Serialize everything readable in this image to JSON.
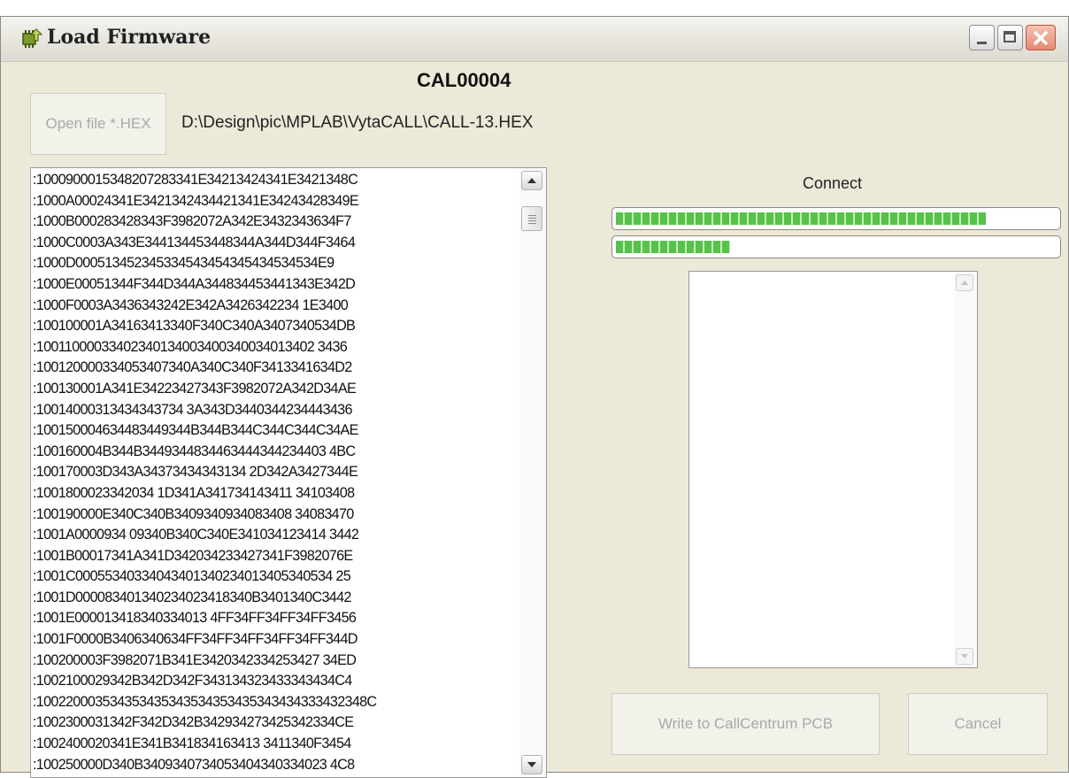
{
  "window": {
    "title": "Load Firmware",
    "minimize_icon": "minimize-icon",
    "maximize_icon": "maximize-icon",
    "close_icon": "close-icon"
  },
  "header": {
    "open_button_label": "Open file *.HEX",
    "device_id": "CAL00004",
    "file_path": "D:\\Design\\pic\\MPLAB\\VytaCALL\\CALL-13.HEX"
  },
  "hex_lines": [
    ":1000900015348207283341E34213424341E3421348C",
    ":1000A00024341E3421342434421341E34243428349E",
    ":1000B000283428343F3982072A342E3432343634F7",
    ":1000C0003A343E344134453448344A344D344F3464",
    ":1000D000513452345334543454345434534534E9",
    ":1000E00051344F344D344A344834453441343E342D",
    ":1000F0003A3436343242E342A3426342234 1E3400",
    ":100100001A34163413340F340C340A3407340534DB",
    ":10011000033402340134003400340034013402 3436",
    ":100120000334053407340A340C340F3413341634D2",
    ":100130001A341E34223427343F3982072A342D34AE",
    ":10014000313434343734 3A343D3440344234443436",
    ":100150004634483449344B344B344C344C344C34AE",
    ":100160004B344B3449344834463444344234403 4BC",
    ":100170003D343A34373434343134 2D342A3427344E",
    ":1001800023342034 1D341A341734143411 34103408",
    ":100190000E340C340B3409340934083408 34083470",
    ":1001A0000934 09340B340C340E341034123414 3442",
    ":1001B00017341A341D342034233427341F3982076E",
    ":1001C00055340334043401340234013405340534 25",
    ":1001D000083401340234023418340B3401340C3442",
    ":1001E000013418340334013 4FF34FF34FF34FF3456",
    ":1001F0000B3406340634FF34FF34FF34FF34FF344D",
    ":100200003F3982071B341E3420342334253427 34ED",
    ":1002100029342B342D342F343134323433343434C4",
    ":100220003534353435343534353435343434333432348C",
    ":1002300031342F342D342B342934273425342334CE",
    ":1002400020341E341B341834163413 3411340F3454",
    ":100250000D340B3409340734053404340334023 4C8"
  ],
  "connect": {
    "label": "Connect",
    "progress_1_fraction": 0.84,
    "progress_2_fraction": 0.26
  },
  "actions": {
    "write_button_label": "Write to CallCentrum PCB",
    "cancel_button_label": "Cancel"
  }
}
